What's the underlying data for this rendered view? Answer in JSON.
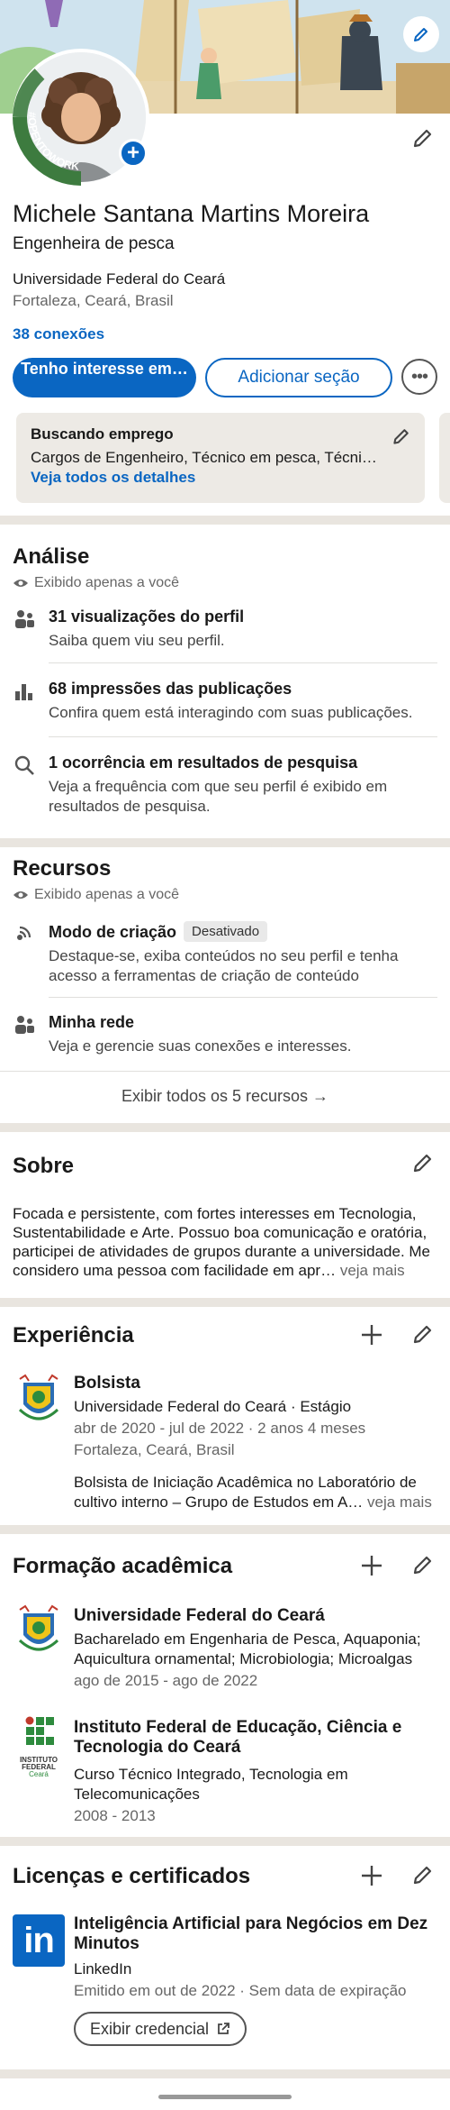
{
  "profile": {
    "open_to_work_frame": "#OPENTOWORK",
    "name": "Michele Santana Martins Moreira",
    "headline": "Engenheira de pesca",
    "education": "Universidade Federal do Ceará",
    "location": "Fortaleza, Ceará, Brasil",
    "connections": "38 conexões",
    "primary_button": "Tenho interesse em…",
    "secondary_button": "Adicionar seção",
    "more_button": "•••"
  },
  "open_to_work": {
    "title": "Buscando emprego",
    "text": "Cargos de Engenheiro, Técnico em pesca, Técnico…",
    "link": "Veja todos os detalhes"
  },
  "analytics": {
    "title": "Análise",
    "private_note": "Exibido apenas a você",
    "items": [
      {
        "title": "31 visualizações do perfil",
        "subtitle": "Saiba quem viu seu perfil."
      },
      {
        "title": "68 impressões das publicações",
        "subtitle": "Confira quem está interagindo com suas publicações."
      },
      {
        "title": "1 ocorrência em resultados de pesquisa",
        "subtitle": "Veja a frequência com que seu perfil é exibido em resultados de pesquisa."
      }
    ]
  },
  "resources": {
    "title": "Recursos",
    "private_note": "Exibido apenas a você",
    "items": [
      {
        "title": "Modo de criação",
        "badge": "Desativado",
        "subtitle": "Destaque-se, exiba conteúdos no seu perfil e tenha acesso a ferramentas de criação de conteúdo"
      },
      {
        "title": "Minha rede",
        "subtitle": "Veja e gerencie suas conexões e interesses."
      }
    ],
    "show_all": "Exibir todos os 5 recursos →"
  },
  "about": {
    "title": "Sobre",
    "text": "Focada e persistente, com fortes interesses em Tecnologia, Sustentabilidade e Arte. Possuo boa comunicação e oratória, participei de atividades de grupos durante a universidade. Me considero uma pessoa com facilidade em apr…",
    "more": "veja mais"
  },
  "experience": {
    "title": "Experiência",
    "items": [
      {
        "role": "Bolsista",
        "company": "Universidade Federal do Ceará · Estágio",
        "dates": "abr de 2020 - jul de 2022 · 2 anos 4 meses",
        "location": "Fortaleza, Ceará, Brasil",
        "description": "Bolsista de Iniciação Acadêmica no Laboratório de cultivo interno – Grupo de Estudos em A…",
        "more": "veja mais"
      }
    ]
  },
  "education_section": {
    "title": "Formação acadêmica",
    "items": [
      {
        "school": "Universidade Federal do Ceará",
        "degree": "Bacharelado em Engenharia de Pesca, Aquaponia; Aquicultura ornamental; Microbiologia; Microalgas",
        "dates": "ago de 2015 - ago de 2022"
      },
      {
        "school": "Instituto Federal de Educação, Ciência e Tecnologia do Ceará",
        "logo_text": [
          "INSTITUTO",
          "FEDERAL",
          "Ceará"
        ],
        "degree": "Curso Técnico Integrado, Tecnologia em Telecomunicações",
        "dates": "2008 - 2013"
      }
    ]
  },
  "licenses": {
    "title": "Licenças e certificados",
    "items": [
      {
        "name": "Inteligência Artificial para Negócios em Dez Minutos",
        "issuer": "LinkedIn",
        "issued": "Emitido em out de 2022 · Sem data de expiração",
        "button": "Exibir credencial",
        "logo_text": "in"
      }
    ]
  },
  "colors": {
    "brand_blue": "#0a66c2",
    "open_to_work_green": "#3d7b3f",
    "section_divider": "#e9e5df"
  }
}
